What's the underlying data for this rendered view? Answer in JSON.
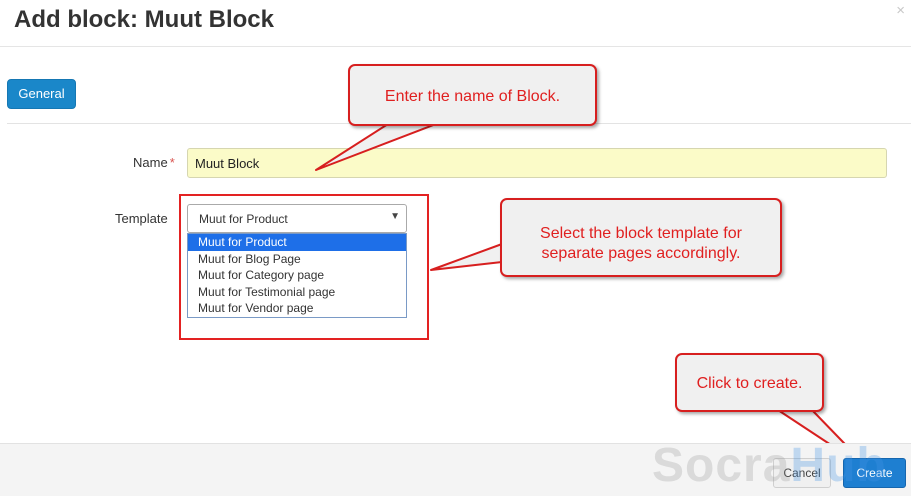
{
  "dialog": {
    "title": "Add block: Muut Block",
    "close_icon": "close-icon"
  },
  "tabs": [
    {
      "label": "General"
    }
  ],
  "form": {
    "name": {
      "label": "Name",
      "required_mark": "*",
      "value": "Muut Block"
    },
    "template": {
      "label": "Template",
      "selected": "Muut for Product",
      "options": [
        "Muut for Product",
        "Muut for Blog Page",
        "Muut for Category page",
        "Muut for Testimonial page",
        "Muut for Vendor page"
      ],
      "highlighted_index": 0
    }
  },
  "callouts": {
    "name_hint": "Enter the name of Block.",
    "template_hint_line1": "Select the block template for",
    "template_hint_line2": "separate pages accordingly.",
    "create_hint": "Click to create."
  },
  "footer": {
    "cancel_label": "Cancel",
    "create_label": "Create"
  },
  "watermark": {
    "part1": "Socra",
    "part2": "Hub"
  },
  "colors": {
    "primary": "#1a87c9",
    "annotation_red": "#e02020",
    "selected_option": "#1e6fe8",
    "input_highlight": "#fbfbc8"
  }
}
